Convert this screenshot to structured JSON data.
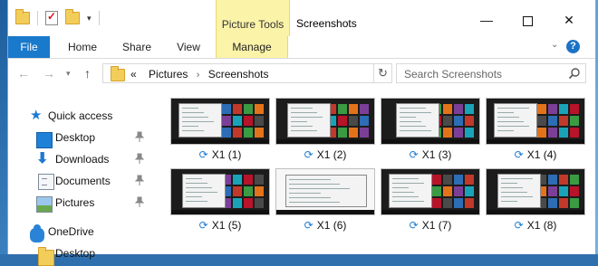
{
  "titlebar": {
    "qat_dropdown": "▾",
    "context_group": "Picture Tools",
    "window_title": "Screenshots",
    "minimize": "—",
    "maximize": "",
    "close": "✕"
  },
  "ribbon": {
    "tabs": [
      "File",
      "Home",
      "Share",
      "View",
      "Manage"
    ],
    "expand_chevron": "⌄",
    "help": "?"
  },
  "nav": {
    "back": "←",
    "forward": "→",
    "recent_dropdown": "▾",
    "up": "↑"
  },
  "address": {
    "overflow": "«",
    "crumbs": [
      "Pictures",
      "Screenshots"
    ],
    "separator": "›",
    "dropdown": "▾",
    "refresh": "↻"
  },
  "search": {
    "placeholder": "Search Screenshots"
  },
  "navpane": {
    "quick_access": "Quick access",
    "items": [
      {
        "label": "Desktop",
        "pinned": true
      },
      {
        "label": "Downloads",
        "pinned": true
      },
      {
        "label": "Documents",
        "pinned": true
      },
      {
        "label": "Pictures",
        "pinned": true
      }
    ],
    "onedrive": "OneDrive",
    "onedrive_child": "Desktop"
  },
  "files": [
    {
      "name": "X1 (1)",
      "sync_icon": "⟳"
    },
    {
      "name": "X1 (2)",
      "sync_icon": "⟳"
    },
    {
      "name": "X1 (3)",
      "sync_icon": "⟳"
    },
    {
      "name": "X1 (4)",
      "sync_icon": "⟳"
    },
    {
      "name": "X1 (5)",
      "sync_icon": "⟳"
    },
    {
      "name": "X1 (6)",
      "sync_icon": "⟳"
    },
    {
      "name": "X1 (7)",
      "sync_icon": "⟳"
    },
    {
      "name": "X1 (8)",
      "sync_icon": "⟳"
    }
  ],
  "colors": {
    "accent": "#1979ca",
    "context_tab": "#fbf3a8",
    "sync": "#1f7bd1"
  }
}
